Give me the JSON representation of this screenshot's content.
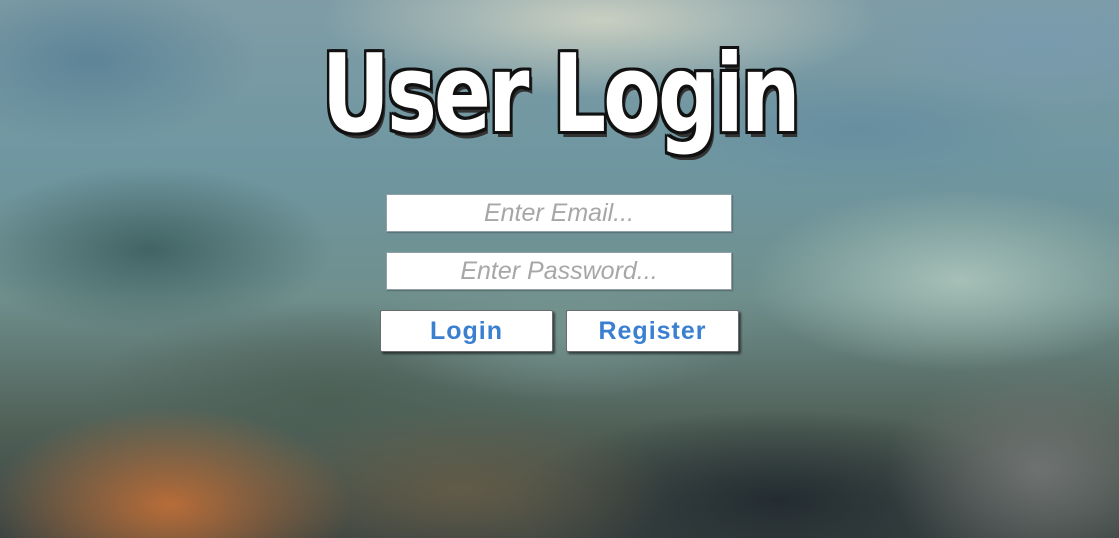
{
  "title": "User Login",
  "email": {
    "value": "",
    "placeholder": "Enter Email..."
  },
  "password": {
    "value": "",
    "placeholder": "Enter Password..."
  },
  "buttons": {
    "login_label": "Login",
    "register_label": "Register"
  },
  "colors": {
    "button_text": "#3a7fd0",
    "placeholder_text": "#a7a7a7",
    "title_fill": "#ffffff",
    "title_outline": "#111111"
  }
}
